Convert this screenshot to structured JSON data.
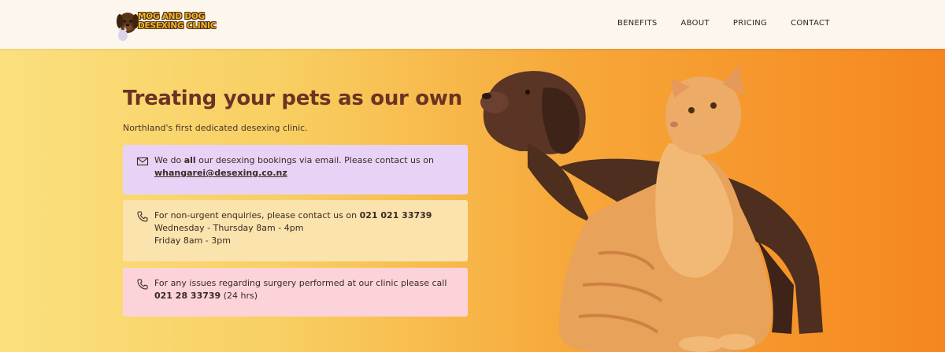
{
  "header": {
    "logo_line1": "MOG AND DOG",
    "logo_line2": "DESEXING CLINIC",
    "nav": [
      "BENEFITS",
      "ABOUT",
      "PRICING",
      "CONTACT"
    ]
  },
  "hero": {
    "title": "Treating your pets as our own",
    "subtitle": "Northland's first dedicated desexing clinic.",
    "email_card": {
      "icon": "envelope-icon",
      "text_before": "We do ",
      "text_bold": "all",
      "text_after": " our desexing bookings via email. Please contact us on",
      "email": "whangarei@desexing.co.nz"
    },
    "phone_card": {
      "icon": "phone-icon",
      "text_before": "For non-urgent enquiries, please contact us on ",
      "phone": "021 021 33739",
      "text_after": " Wednesday - Thursday 8am - 4pm",
      "hours2": "Friday 8am - 3pm"
    },
    "urgent_card": {
      "icon": "phone-icon",
      "text": "For any issues regarding surgery performed at our clinic please call",
      "phone": "021 28 33739",
      "note": " (24 hrs)"
    }
  },
  "colors": {
    "header_bg": "#fdf6ec",
    "title": "#6b3322",
    "email_card_bg": "#e8d3f7",
    "phone_card_bg": "#fbe3ad",
    "urgent_card_bg": "#fcd3d8",
    "gradient_start": "#fbe07f",
    "gradient_end": "#f5861f"
  }
}
